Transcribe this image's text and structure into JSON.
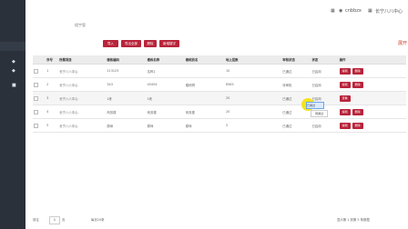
{
  "topbar": {
    "user_name": "cnbbzx",
    "center_name": "长宁八八中心",
    "breadcrumb": "楼宇管"
  },
  "toolbar": {
    "import_label": "导入",
    "export_all_label": "导出全部",
    "delete_label": "删除",
    "add_label": "新增楼宇",
    "right_text": "展开"
  },
  "table": {
    "headers": [
      "序号",
      "所属项目",
      "楼栋编码",
      "楼栋名称",
      "楼栋别名",
      "地上层数",
      "审核状态",
      "状态",
      "操作"
    ],
    "rows": [
      [
        "1",
        "长宁八八中心",
        "213123",
        "名称1",
        "",
        "10",
        "已通过",
        "已启用"
      ],
      [
        "2",
        "长宁八八中心",
        "343",
        "45454",
        "楼栋啊",
        "6565",
        "待审批",
        "已启用"
      ],
      [
        "3",
        "长宁八八中心",
        "1栋",
        "1栋",
        "",
        "20",
        "已通过",
        "已启用"
      ],
      [
        "4",
        "长宁八八中心",
        "商务楼",
        "商务楼",
        "商务楼",
        "20",
        "已通过",
        "已启用"
      ],
      [
        "5",
        "长宁八八中心",
        "原垛",
        "原垛",
        "原垛",
        "5",
        "已通过",
        "已启用"
      ]
    ],
    "actions": {
      "edit": "编辑",
      "delete": "删除",
      "view": "查看"
    }
  },
  "overlay": {
    "cell_value": "已通过",
    "tooltip": "待通过"
  },
  "footer": {
    "page_label": "前往",
    "page_value": "1",
    "page_unit": "页",
    "page_size": "每页20条",
    "summary": "显示第 1 到第 5 条数据"
  },
  "colors": {
    "accent": "#b8243a",
    "sidebar": "#2b313b"
  }
}
